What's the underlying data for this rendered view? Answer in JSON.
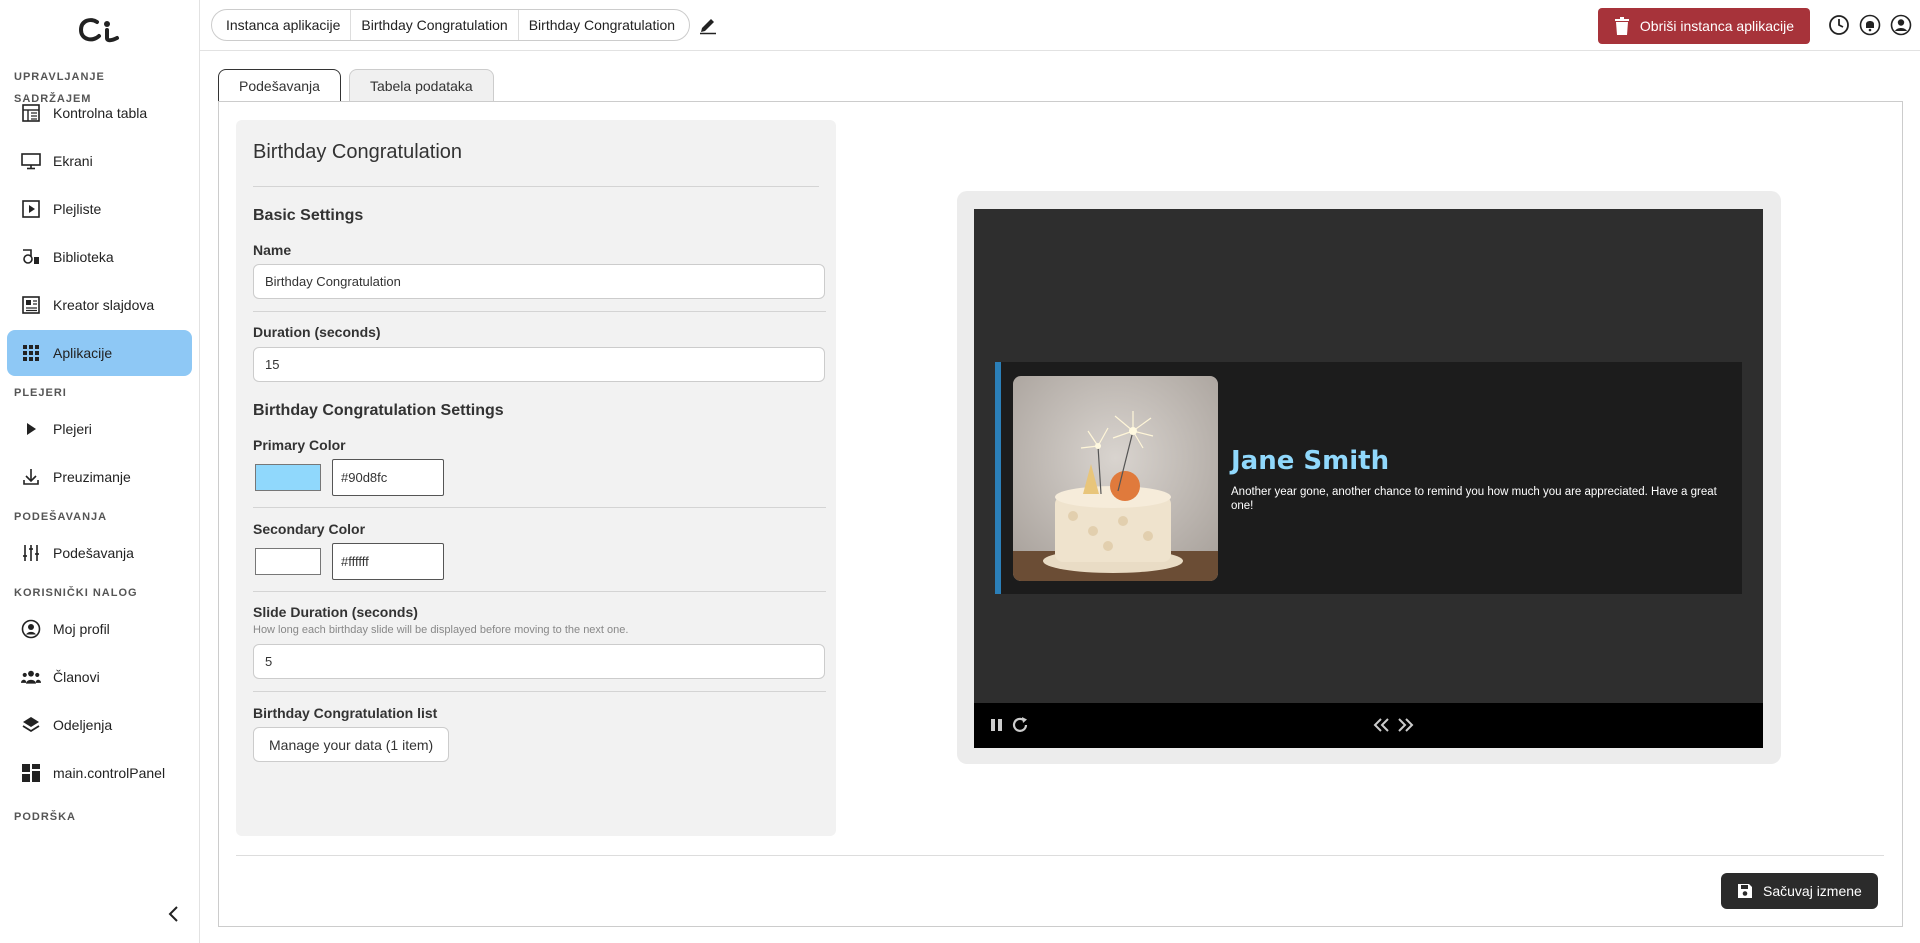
{
  "sidebar": {
    "sections": [
      {
        "title": "UPRAVLJANJE SADRŽAJEM",
        "items": [
          {
            "label": "Kontrolna tabla",
            "icon": "dashboard-icon"
          },
          {
            "label": "Ekrani",
            "icon": "monitor-icon"
          },
          {
            "label": "Plejliste",
            "icon": "playlist-icon"
          },
          {
            "label": "Biblioteka",
            "icon": "library-icon"
          },
          {
            "label": "Kreator slajdova",
            "icon": "slide-creator-icon"
          },
          {
            "label": "Aplikacije",
            "icon": "apps-grid-icon",
            "active": true
          }
        ]
      },
      {
        "title": "PLEJERI",
        "items": [
          {
            "label": "Plejeri",
            "icon": "play-icon"
          },
          {
            "label": "Preuzimanje",
            "icon": "download-icon"
          }
        ]
      },
      {
        "title": "PODEŠAVANJA",
        "items": [
          {
            "label": "Podešavanja",
            "icon": "sliders-icon"
          }
        ]
      },
      {
        "title": "KORISNIČKI NALOG",
        "items": [
          {
            "label": "Moj profil",
            "icon": "profile-icon"
          },
          {
            "label": "Članovi",
            "icon": "members-icon"
          },
          {
            "label": "Odeljenja",
            "icon": "layers-icon"
          },
          {
            "label": "main.controlPanel",
            "icon": "control-panel-icon"
          }
        ]
      },
      {
        "title": "PODRŠKA",
        "items": []
      }
    ]
  },
  "header": {
    "breadcrumb": [
      "Instanca aplikacije",
      "Birthday Congratulation",
      "Birthday Congratulation"
    ],
    "delete_label": "Obriši instanca aplikacije"
  },
  "tabs": [
    {
      "label": "Podešavanja",
      "active": true
    },
    {
      "label": "Tabela podataka",
      "active": false
    }
  ],
  "form": {
    "title": "Birthday Congratulation",
    "basic_heading": "Basic Settings",
    "name_label": "Name",
    "name_value": "Birthday Congratulation",
    "duration_label": "Duration (seconds)",
    "duration_value": "15",
    "app_heading": "Birthday Congratulation Settings",
    "primary_label": "Primary Color",
    "primary_value": "#90d8fc",
    "secondary_label": "Secondary Color",
    "secondary_value": "#ffffff",
    "slide_duration_label": "Slide Duration (seconds)",
    "slide_duration_hint": "How long each birthday slide will be displayed before moving to the next one.",
    "slide_duration_value": "5",
    "list_label": "Birthday Congratulation list",
    "manage_button": "Manage your data (1 item)"
  },
  "preview": {
    "name": "Jane Smith",
    "message": "Another year gone, another chance to remind you how much you are appreciated. Have a great one!",
    "accent_color": "#2b7fb8",
    "name_color": "#90d8fc"
  },
  "footer": {
    "save_label": "Sačuvaj izmene"
  }
}
